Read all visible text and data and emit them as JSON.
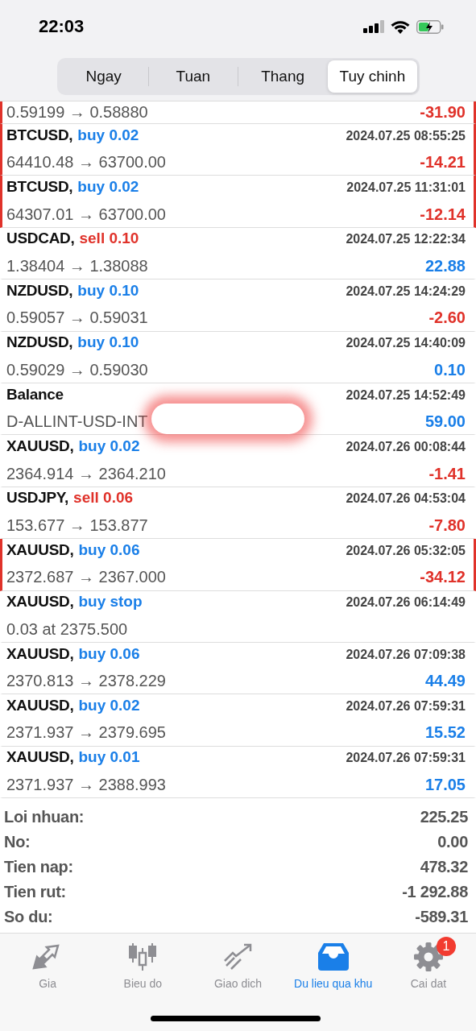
{
  "status_bar": {
    "time": "22:03"
  },
  "period_tabs": [
    {
      "label": "Ngay",
      "selected": false
    },
    {
      "label": "Tuan",
      "selected": false
    },
    {
      "label": "Thang",
      "selected": false
    },
    {
      "label": "Tuy chinh",
      "selected": true
    }
  ],
  "deals": [
    {
      "details": "0.59199 → 0.58880",
      "profit": "-31.90",
      "loss": true,
      "flagged": true
    },
    {
      "symbol": "BTCUSD,",
      "action": "buy 0.02",
      "sell": false,
      "time": "2024.07.25 08:55:25",
      "details": "64410.48 → 63700.00",
      "profit": "-14.21",
      "loss": true,
      "flagged": true
    },
    {
      "symbol": "BTCUSD,",
      "action": "buy 0.02",
      "sell": false,
      "time": "2024.07.25 11:31:01",
      "details": "64307.01 → 63700.00",
      "profit": "-12.14",
      "loss": true,
      "flagged": true
    },
    {
      "symbol": "USDCAD,",
      "action": "sell 0.10",
      "sell": true,
      "time": "2024.07.25 12:22:34",
      "details": "1.38404 → 1.38088",
      "profit": "22.88",
      "loss": false,
      "flagged": false
    },
    {
      "symbol": "NZDUSD,",
      "action": "buy 0.10",
      "sell": false,
      "time": "2024.07.25 14:24:29",
      "details": "0.59057 → 0.59031",
      "profit": "-2.60",
      "loss": true,
      "flagged": false
    },
    {
      "symbol": "NZDUSD,",
      "action": "buy 0.10",
      "sell": false,
      "time": "2024.07.25 14:40:09",
      "details": "0.59029 → 0.59030",
      "profit": "0.10",
      "loss": false,
      "flagged": false
    },
    {
      "symbol": "Balance",
      "time": "2024.07.25 14:52:49",
      "details": "D-ALLINT-USD-INT",
      "redacted": true,
      "profit": "59.00",
      "loss": false,
      "flagged": false
    },
    {
      "symbol": "XAUUSD,",
      "action": "buy 0.02",
      "sell": false,
      "time": "2024.07.26 00:08:44",
      "details": "2364.914 → 2364.210",
      "profit": "-1.41",
      "loss": true,
      "flagged": false
    },
    {
      "symbol": "USDJPY,",
      "action": "sell 0.06",
      "sell": true,
      "time": "2024.07.26 04:53:04",
      "details": "153.677 → 153.877",
      "profit": "-7.80",
      "loss": true,
      "flagged": false
    },
    {
      "symbol": "XAUUSD,",
      "action": "buy 0.06",
      "sell": false,
      "time": "2024.07.26 05:32:05",
      "details": "2372.687 → 2367.000",
      "profit": "-34.12",
      "loss": true,
      "flagged": true
    },
    {
      "symbol": "XAUUSD,",
      "action": "buy stop",
      "sell": false,
      "time": "2024.07.26 06:14:49",
      "details": "0.03 at 2375.500",
      "flagged": false
    },
    {
      "symbol": "XAUUSD,",
      "action": "buy 0.06",
      "sell": false,
      "time": "2024.07.26 07:09:38",
      "details": "2370.813 → 2378.229",
      "profit": "44.49",
      "loss": false,
      "flagged": false
    },
    {
      "symbol": "XAUUSD,",
      "action": "buy 0.02",
      "sell": false,
      "time": "2024.07.26 07:59:31",
      "details": "2371.937 → 2379.695",
      "profit": "15.52",
      "loss": false,
      "flagged": false
    },
    {
      "symbol": "XAUUSD,",
      "action": "buy 0.01",
      "sell": false,
      "time": "2024.07.26 07:59:31",
      "details": "2371.937 → 2388.993",
      "profit": "17.05",
      "loss": false,
      "flagged": false
    }
  ],
  "summary": [
    {
      "label": "Loi nhuan:",
      "value": "225.25"
    },
    {
      "label": "No:",
      "value": "0.00"
    },
    {
      "label": "Tien nap:",
      "value": "478.32"
    },
    {
      "label": "Tien rut:",
      "value": "-1 292.88"
    },
    {
      "label": "So du:",
      "value": "-589.31"
    }
  ],
  "tab_bar": [
    {
      "kind": "quotes",
      "label": "Gia",
      "selected": false
    },
    {
      "kind": "chart",
      "label": "Bieu do",
      "selected": false
    },
    {
      "kind": "trade",
      "label": "Giao dich",
      "selected": false
    },
    {
      "kind": "history",
      "label": "Du lieu qua khu",
      "selected": true
    },
    {
      "kind": "settings",
      "label": "Cai dat",
      "selected": false,
      "badge": "1"
    }
  ]
}
